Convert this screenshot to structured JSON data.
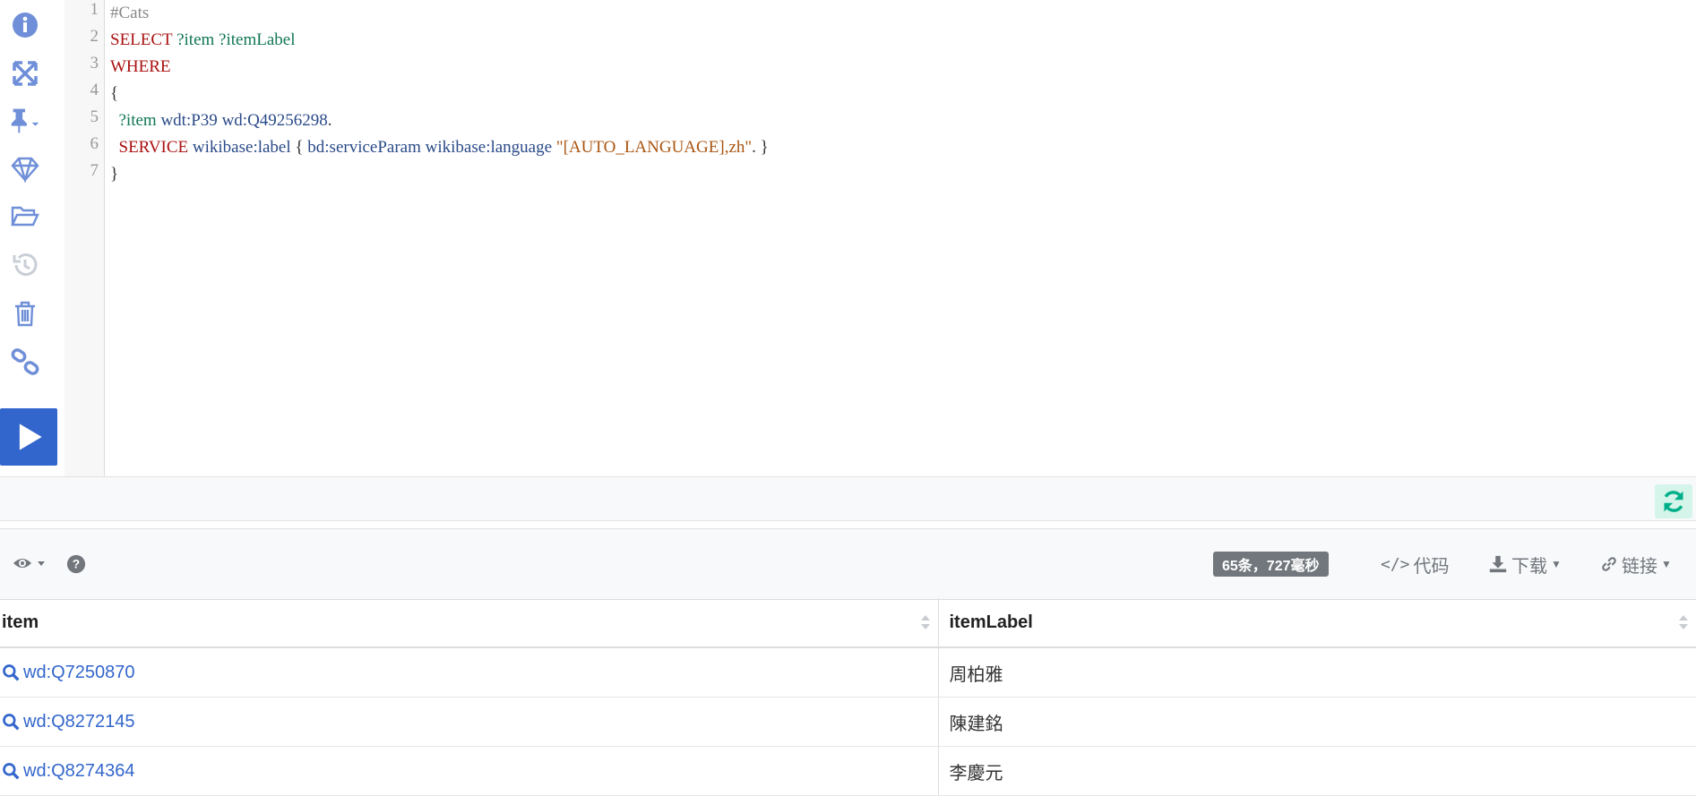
{
  "sidebar": {
    "icons": [
      "info-icon",
      "expand-icon",
      "pin-icon",
      "diamond-icon",
      "folder-open-icon",
      "history-icon",
      "trash-icon",
      "link-icon"
    ]
  },
  "editor": {
    "line_numbers": [
      "1",
      "2",
      "3",
      "4",
      "5",
      "6",
      "7"
    ],
    "lines": [
      [
        {
          "t": "#Cats",
          "c": "comment"
        }
      ],
      [
        {
          "t": "SELECT",
          "c": "kw"
        },
        {
          "t": " ",
          "c": "plain"
        },
        {
          "t": "?item",
          "c": "var"
        },
        {
          "t": " ",
          "c": "plain"
        },
        {
          "t": "?itemLabel",
          "c": "var"
        }
      ],
      [
        {
          "t": "WHERE",
          "c": "kw"
        }
      ],
      [
        {
          "t": "{",
          "c": "plain"
        }
      ],
      [
        {
          "t": "  ",
          "c": "plain"
        },
        {
          "t": "?item",
          "c": "var"
        },
        {
          "t": " ",
          "c": "plain"
        },
        {
          "t": "wdt:P39",
          "c": "prefix"
        },
        {
          "t": " ",
          "c": "plain"
        },
        {
          "t": "wd:Q49256298",
          "c": "prefix"
        },
        {
          "t": ".",
          "c": "plain"
        }
      ],
      [
        {
          "t": "  ",
          "c": "plain"
        },
        {
          "t": "SERVICE",
          "c": "kw"
        },
        {
          "t": " ",
          "c": "plain"
        },
        {
          "t": "wikibase:label",
          "c": "prefix"
        },
        {
          "t": " { ",
          "c": "plain"
        },
        {
          "t": "bd:serviceParam",
          "c": "prefix"
        },
        {
          "t": " ",
          "c": "plain"
        },
        {
          "t": "wikibase:language",
          "c": "prefix"
        },
        {
          "t": " ",
          "c": "plain"
        },
        {
          "t": "\"[AUTO_LANGUAGE],zh\"",
          "c": "str"
        },
        {
          "t": ". }",
          "c": "plain"
        }
      ],
      [
        {
          "t": "}",
          "c": "plain"
        }
      ]
    ]
  },
  "results_toolbar": {
    "result_summary": "65条，727毫秒",
    "code_label": "代码",
    "download_label": "下载",
    "link_label": "链接"
  },
  "table": {
    "columns": [
      "item",
      "itemLabel"
    ],
    "rows": [
      {
        "item": "wd:Q7250870",
        "itemLabel": "周柏雅"
      },
      {
        "item": "wd:Q8272145",
        "itemLabel": "陳建銘"
      },
      {
        "item": "wd:Q8274364",
        "itemLabel": "李慶元"
      }
    ]
  },
  "colors": {
    "run_button": "#3366cc",
    "icon_color": "#6f8fd8",
    "refresh_bg": "#d5f5ea",
    "refresh_icon": "#00af89",
    "link_color": "#3366cc"
  }
}
